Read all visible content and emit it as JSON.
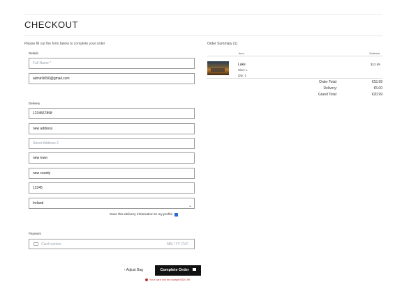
{
  "page": {
    "title": "CHECKOUT"
  },
  "form": {
    "helper_text": "Please fill out the form below to complete your order",
    "details_label": "Details",
    "full_name_placeholder": "Full Name *",
    "email_value": "admin9090@gmail.com",
    "delivery_label": "Delivery",
    "phone_value": "1234567898",
    "street1_value": "new address",
    "street2_placeholder": "Street Address 2",
    "town_value": "new town",
    "county_value": "new county",
    "postcode_value": "12345",
    "country_value": "Ireland",
    "save_info_label": "Save this delivery information to my profile",
    "payment_label": "Payment",
    "card_placeholder": "Card number",
    "card_right_placeholder": "MM / YY  CVC"
  },
  "actions": {
    "adjust_bag": "Adjust Bag",
    "complete_order": "Complete Order",
    "charge_notice": "Your card will be charged $20.99"
  },
  "summary": {
    "title": "Order Summary (1)",
    "col_item": "Item",
    "col_subtotal": "Subtotal",
    "item": {
      "name": "Lake",
      "size": "Size: L",
      "qty": "Qty: 1",
      "price": "$12.99"
    },
    "totals": [
      {
        "label": "Order Total:",
        "value": "€15.99"
      },
      {
        "label": "Delivery:",
        "value": "€5.00"
      },
      {
        "label": "Grand Total:",
        "value": "€20.99"
      }
    ]
  },
  "icons": [
    "card-icon",
    "chevron-down-icon",
    "chevron-left-icon",
    "lock-icon",
    "warning-icon",
    "checkbox-checked-icon"
  ]
}
